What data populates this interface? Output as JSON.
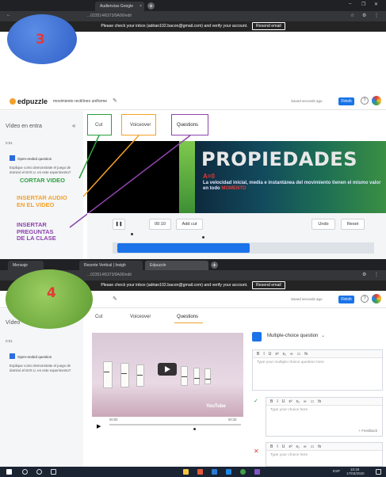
{
  "panel1": {
    "step_number": "3",
    "browser": {
      "tabs": [
        {
          "label": "Audiencias Google",
          "close": "×"
        }
      ],
      "new_tab": "+",
      "url": "...023514/6373/9A00/edit",
      "window_controls": [
        "–",
        "❐",
        "✕"
      ]
    },
    "banner": {
      "text": "Please check your inbox (adrian102.bacon@gmail.com) and verify your account.",
      "action": "Resend email"
    },
    "header": {
      "logo": "edpuzzle",
      "lesson_title": "movimiento rectilíneo uniforme",
      "saved_text": "Saved seconds ago",
      "finish_label": "Finish",
      "help": "?"
    },
    "sidebar": {
      "title": "Vídeo en entra",
      "collapse": "«",
      "time": "0:01",
      "question": {
        "type": "Open-ended question",
        "text": "Explique como demonstrate el juego de dominó el M.R.U. en este experimento?"
      }
    },
    "tabs": [
      {
        "label": "Cut"
      },
      {
        "label": "Voiceover"
      },
      {
        "label": "Questions"
      }
    ],
    "slide": {
      "title": "PROPIEDADES",
      "subtitle": "A=0",
      "body_before": "La velocidad inicial, media e instantánea del movimiento tienen el mismo valor en todo",
      "body_highlight": "MOMENTO"
    },
    "controls": {
      "pause": "❚❚",
      "time": "00:10",
      "add_cut": "Add cut",
      "undo": "Undo",
      "reset": "Reset"
    },
    "annotations": {
      "cut": "CORTAR VIDEO",
      "audio": "INSERTAR AUDIO\nEN EL VIDEO",
      "questions": "INSERTAR\nPREGUNTAS\nDE LA CLASE"
    }
  },
  "panel2": {
    "step_number": "4",
    "browser": {
      "tabs": [
        {
          "label": "Mensaje"
        },
        {
          "label": "Resorte Vertical | Insigh"
        },
        {
          "label": "Edpuzzle"
        }
      ],
      "url": "...023514/6373/9A00/edit"
    },
    "banner": {
      "text": "Please check your inbox (adrian102.bacon@gmail.com) and verify your account.",
      "action": "Resend email"
    },
    "header": {
      "saved_text": "Saved seconds ago",
      "finish_label": "Finish",
      "help": "?"
    },
    "sidebar": {
      "title": "Vídeo",
      "time": "0:01",
      "question": {
        "type": "Open-ended question",
        "text": "Explique como demonstrate el juego de dominó el M.R.U. en este experimento?"
      }
    },
    "tabs": [
      {
        "label": "Cut"
      },
      {
        "label": "Voiceover"
      },
      {
        "label": "Questions"
      }
    ],
    "video": {
      "watermark": "YouTube",
      "time_start": "00:00",
      "time_end": "00:33",
      "play": "▶"
    },
    "question_editor": {
      "type_label": "Multiple-choice question",
      "toolbar": [
        "B",
        "I",
        "U",
        "x²",
        "x₂",
        "∞",
        "▭",
        "fx"
      ],
      "question_placeholder": "Type your multiple-choice question here",
      "choice_placeholder": "Type your choice here",
      "feedback_label": "+ Feedback",
      "choice2_placeholder": "Type your choice here"
    },
    "taskbar": {
      "clock_time": "10:29",
      "clock_date": "17/03/2020",
      "lang": "ESP"
    }
  },
  "colors": {
    "accent": "#1a73e8",
    "cut_box": "#2e9e3f",
    "voiceover_box": "#f3a12b",
    "questions_box": "#8e44ad",
    "label_green": "#2e9e3f",
    "label_orange": "#f3a12b",
    "label_purple": "#8e44ad",
    "step_red": "#e53935"
  }
}
